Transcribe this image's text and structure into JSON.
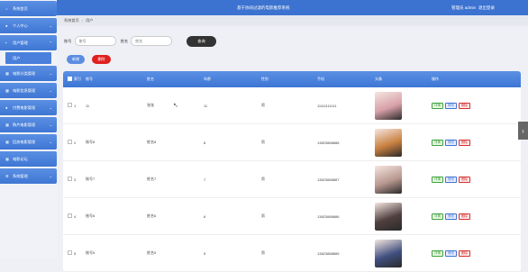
{
  "sidebar": {
    "items": [
      {
        "label": "系统首页",
        "icon": "home-icon",
        "expand": false
      },
      {
        "label": "个人中心",
        "icon": "user-icon",
        "expand": true
      },
      {
        "label": "用户管理",
        "icon": "users-icon",
        "expand": true
      },
      {
        "label": "电影分类管理",
        "icon": "grid-icon",
        "expand": true
      },
      {
        "label": "电影信息管理",
        "icon": "grid-icon",
        "expand": true
      },
      {
        "label": "付费电影管理",
        "icon": "user-icon",
        "expand": true
      },
      {
        "label": "购片电影管理",
        "icon": "grid-icon",
        "expand": true
      },
      {
        "label": "回放电影管理",
        "icon": "grid-icon",
        "expand": true
      },
      {
        "label": "电影论坛",
        "icon": "grid-icon",
        "expand": false
      },
      {
        "label": "系统管理",
        "icon": "gear-icon",
        "expand": true
      }
    ],
    "sub_active": "用户"
  },
  "header": {
    "title": "基于协同过滤的电影推荐系统",
    "admin": "管理员 admin",
    "logout": "退出登录"
  },
  "breadcrumb": {
    "home": "系统首页",
    "sep": "/",
    "current": "用户"
  },
  "search": {
    "account_label": "账号",
    "account_placeholder": "账号",
    "name_label": "姓名",
    "name_placeholder": "姓名",
    "query_button": "查询"
  },
  "actions": {
    "add": "新增",
    "delete": "删除"
  },
  "table": {
    "headers": [
      "索引",
      "账号",
      "姓名",
      "年龄",
      "性别",
      "手机",
      "头像",
      "操作"
    ],
    "rows": [
      {
        "index": "1",
        "account": "11",
        "name": "张张",
        "age": "11",
        "gender": "男",
        "phone": "11111111111",
        "photo": "#d8a0a8"
      },
      {
        "index": "2",
        "account": "账号8",
        "name": "姓名8",
        "age": "8",
        "gender": "男",
        "phone": "13823888888",
        "photo": "#c98040"
      },
      {
        "index": "3",
        "account": "账号7",
        "name": "姓名7",
        "age": "7",
        "gender": "男",
        "phone": "13823888887",
        "photo": "#b89890"
      },
      {
        "index": "4",
        "account": "账号6",
        "name": "姓名6",
        "age": "6",
        "gender": "男",
        "phone": "13823888886",
        "photo": "#504040"
      },
      {
        "index": "5",
        "account": "账号5",
        "name": "姓名5",
        "age": "5",
        "gender": "男",
        "phone": "13823888885",
        "photo": "#405080"
      }
    ],
    "row_actions": {
      "detail": "详情",
      "edit": "修改",
      "delete": "删除"
    }
  },
  "colors": {
    "primary": "#3c73d1",
    "danger": "#e02020",
    "dark": "#333333"
  }
}
